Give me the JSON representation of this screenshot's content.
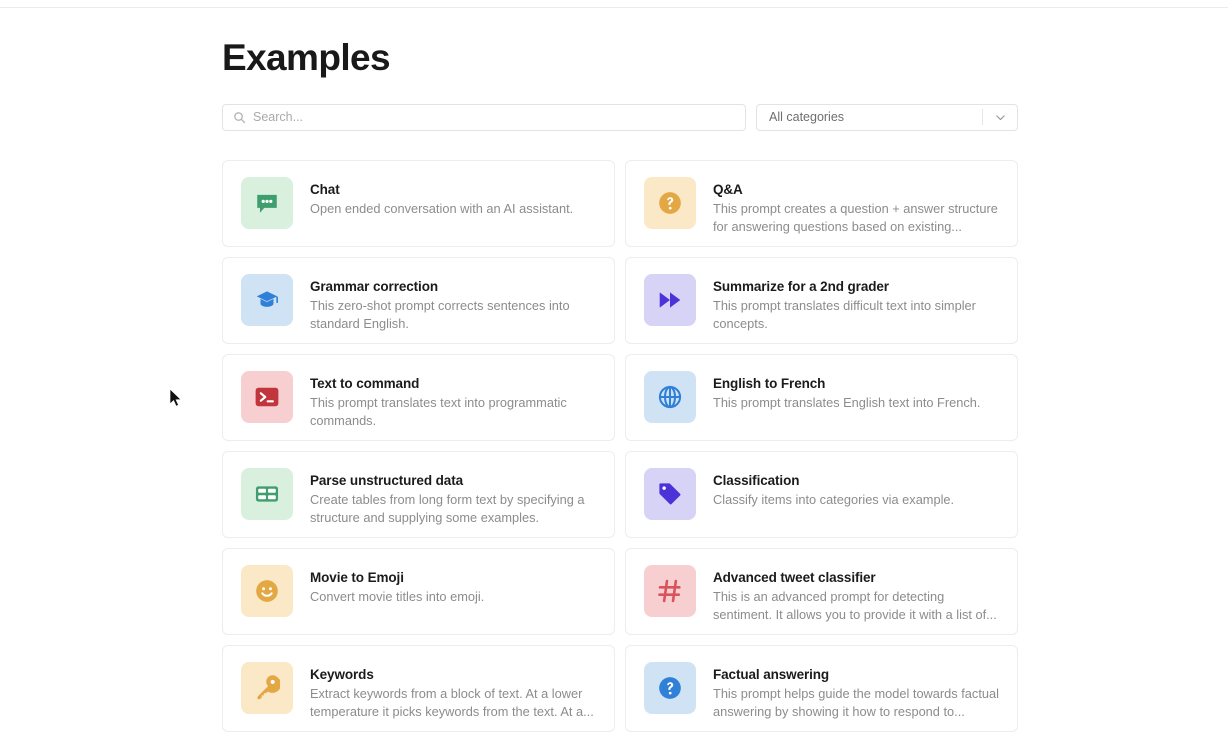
{
  "header": {
    "title": "Examples"
  },
  "search": {
    "placeholder": "Search...",
    "value": "",
    "icon": "search-icon"
  },
  "category_filter": {
    "selected": "All categories",
    "icon": "chevron-down-icon",
    "options": [
      "All categories"
    ]
  },
  "cards": [
    {
      "title": "Chat",
      "description": "Open ended conversation with an AI assistant.",
      "icon": "chat-bubble-icon",
      "tile_color": "#d9f0de",
      "glyph_color": "#3f9e6d"
    },
    {
      "title": "Q&A",
      "description": "This prompt creates a question + answer structure for answering questions based on existing...",
      "icon": "question-circle-icon",
      "tile_color": "#fae8c6",
      "glyph_color": "#e3a844"
    },
    {
      "title": "Grammar correction",
      "description": "This zero-shot prompt corrects sentences into standard English.",
      "icon": "graduation-cap-icon",
      "tile_color": "#cfe3f5",
      "glyph_color": "#2f80d6"
    },
    {
      "title": "Summarize for a 2nd grader",
      "description": "This prompt translates difficult text into simpler concepts.",
      "icon": "fast-forward-icon",
      "tile_color": "#d7d3f7",
      "glyph_color": "#4b33d8"
    },
    {
      "title": "Text to command",
      "description": "This prompt translates text into programmatic commands.",
      "icon": "terminal-icon",
      "tile_color": "#f7cfd1",
      "glyph_color": "#c0363c"
    },
    {
      "title": "English to French",
      "description": "This prompt translates English text into French.",
      "icon": "globe-icon",
      "tile_color": "#cfe3f5",
      "glyph_color": "#2f80d6"
    },
    {
      "title": "Parse unstructured data",
      "description": "Create tables from long form text by specifying a structure and supplying some examples.",
      "icon": "table-icon",
      "tile_color": "#d9f0de",
      "glyph_color": "#3f9e6d"
    },
    {
      "title": "Classification",
      "description": "Classify items into categories via example.",
      "icon": "tag-icon",
      "tile_color": "#d7d3f7",
      "glyph_color": "#4b33d8"
    },
    {
      "title": "Movie to Emoji",
      "description": "Convert movie titles into emoji.",
      "icon": "smiley-face-icon",
      "tile_color": "#fae8c6",
      "glyph_color": "#e3a844"
    },
    {
      "title": "Advanced tweet classifier",
      "description": "This is an advanced prompt for detecting sentiment. It allows you to provide it with a list of...",
      "icon": "hashtag-icon",
      "tile_color": "#f7cfd1",
      "glyph_color": "#d9535c"
    },
    {
      "title": "Keywords",
      "description": "Extract keywords from a block of text. At a lower temperature it picks keywords from the text. At a...",
      "icon": "key-icon",
      "tile_color": "#fae8c6",
      "glyph_color": "#e3a844"
    },
    {
      "title": "Factual answering",
      "description": "This prompt helps guide the model towards factual answering by showing it how to respond to...",
      "icon": "question-circle-icon",
      "tile_color": "#cfe3f5",
      "glyph_color": "#2f80d6"
    }
  ]
}
